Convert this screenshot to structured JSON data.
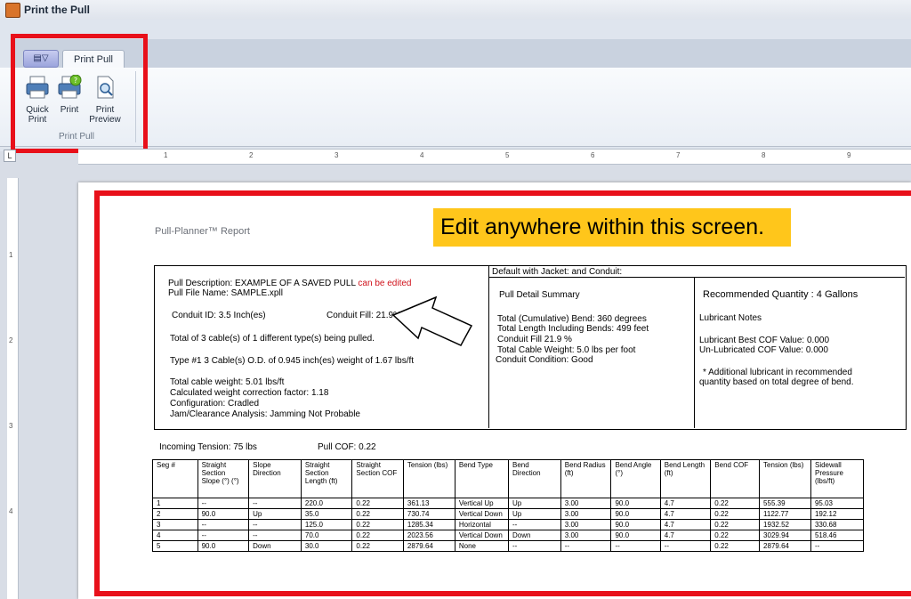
{
  "window": {
    "title": "Print the Pull"
  },
  "ribbon": {
    "app_menu": "▤▽",
    "tab": "Print Pull",
    "buttons": [
      {
        "label": "Quick Print",
        "icon": "quick-print-icon"
      },
      {
        "label": "Print",
        "icon": "print-icon"
      },
      {
        "label": "Print Preview",
        "icon": "print-preview-icon"
      }
    ],
    "group_label": "Print Pull"
  },
  "ruler": {
    "corner": "L",
    "marks": [
      "1",
      "2",
      "3",
      "4",
      "5",
      "6",
      "7",
      "8",
      "9"
    ],
    "vmarks": [
      "1",
      "2",
      "3",
      "4"
    ]
  },
  "callout": "Edit anywhere within this screen.",
  "report": {
    "title": "Pull-Planner™ Report",
    "pull_description_label": "Pull Description: EXAMPLE OF A SAVED PULL",
    "pull_description_note": "can be edited",
    "pull_file_name": "Pull File Name: SAMPLE.xpll",
    "conduit_id": "Conduit ID: 3.5  Inch(es)",
    "conduit_fill": "Conduit Fill: 21.9%",
    "cables_being_pulled": "Total of 3  cable(s) of 1  different type(s) being pulled.",
    "type1": "Type #1   3 Cable(s)    O.D. of 0.945  inch(es)  weight of 1.67  lbs/ft",
    "total_cable_weight": "Total cable weight: 5.01  lbs/ft",
    "weight_correction": "Calculated weight correction factor:  1.18",
    "configuration": "Configuration:  Cradled",
    "jam_analysis": "Jam/Clearance Analysis:  Jamming Not Probable",
    "default_header": "Default with Jacket:  and Conduit:",
    "detail_title": "Pull Detail Summary",
    "detail_lines": [
      "Total (Cumulative) Bend: 360  degrees",
      "Total Length Including Bends: 499  feet",
      "Conduit Fill 21.9 %",
      "Total Cable Weight: 5.0  lbs per foot",
      "Conduit Condition:  Good"
    ],
    "recommended_qty": "Recommended Quantity  :  4  Gallons",
    "lubricant_notes": "Lubricant Notes",
    "best_cof": "Lubricant Best COF Value: 0.000",
    "unlub_cof": "Un-Lubricated COF Value: 0.000",
    "additional_note_1": "* Additional lubricant in recommended",
    "additional_note_2": "quantity based on total degree of bend.",
    "incoming_tension": "Incoming Tension: 75  lbs",
    "pull_cof": "Pull COF: 0.22"
  },
  "table": {
    "headers": [
      "Seg #",
      "Straight Section Slope (°) (°)",
      "Slope Direction",
      "Straight Section Length (ft)",
      "Straight Section COF",
      "Tension (lbs)",
      "Bend Type",
      "Bend Direction",
      "Bend Radius (ft)",
      "Bend Angle (°)",
      "Bend Length (ft)",
      "Bend COF",
      "Tension (lbs)",
      "Sidewall Pressure (lbs/ft)"
    ],
    "rows": [
      [
        "1",
        "--",
        "--",
        "220.0",
        "0.22",
        "361.13",
        "Vertical Up",
        "Up",
        "3.00",
        "90.0",
        "4.7",
        "0.22",
        "555.39",
        "95.03"
      ],
      [
        "2",
        "90.0",
        "Up",
        "35.0",
        "0.22",
        "730.74",
        "Vertical Down",
        "Up",
        "3.00",
        "90.0",
        "4.7",
        "0.22",
        "1122.77",
        "192.12"
      ],
      [
        "3",
        "--",
        "--",
        "125.0",
        "0.22",
        "1285.34",
        "Horizontal",
        "--",
        "3.00",
        "90.0",
        "4.7",
        "0.22",
        "1932.52",
        "330.68"
      ],
      [
        "4",
        "--",
        "--",
        "70.0",
        "0.22",
        "2023.56",
        "Vertical Down",
        "Down",
        "3.00",
        "90.0",
        "4.7",
        "0.22",
        "3029.94",
        "518.46"
      ],
      [
        "5",
        "90.0",
        "Down",
        "30.0",
        "0.22",
        "2879.64",
        "None",
        "--",
        "--",
        "--",
        "--",
        "0.22",
        "2879.64",
        "--"
      ]
    ]
  },
  "colors": {
    "highlight_red": "#e8101a",
    "callout_yellow": "#ffc61b",
    "edit_note_red": "#d0121b"
  }
}
